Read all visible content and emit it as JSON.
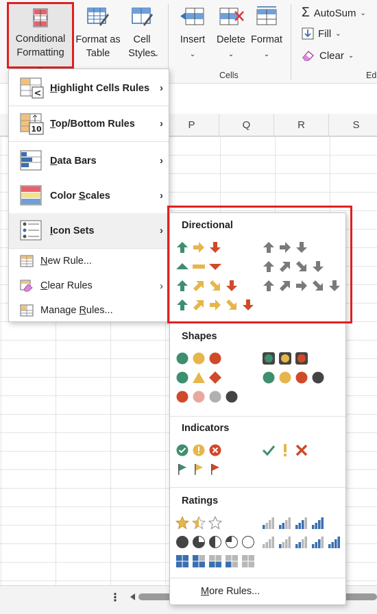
{
  "ribbon": {
    "conditional_formatting": "Conditional\nFormatting",
    "format_as_table": "Format as\nTable",
    "cell_styles": "Cell\nStyles",
    "insert": "Insert",
    "delete": "Delete",
    "format": "Format",
    "cells_group": "Cells",
    "editing_group_partial": "Edi",
    "autosum": "AutoSum",
    "fill": "Fill",
    "clear": "Clear"
  },
  "sheet": {
    "columns": [
      "P",
      "Q",
      "R",
      "S"
    ]
  },
  "menu": {
    "items": [
      {
        "pre": "",
        "ul": "H",
        "post": "ighlight Cells Rules"
      },
      {
        "pre": "",
        "ul": "T",
        "post": "op/Bottom Rules"
      },
      {
        "pre": "",
        "ul": "D",
        "post": "ata Bars"
      },
      {
        "pre": "Color ",
        "ul": "S",
        "post": "cales"
      },
      {
        "pre": "",
        "ul": "I",
        "post": "con Sets"
      },
      {
        "pre": "",
        "ul": "N",
        "post": "ew Rule..."
      },
      {
        "pre": "",
        "ul": "C",
        "post": "lear Rules"
      },
      {
        "pre": "Manage ",
        "ul": "R",
        "post": "ules..."
      }
    ]
  },
  "submenu": {
    "directional": "Directional",
    "shapes": "Shapes",
    "indicators": "Indicators",
    "ratings": "Ratings",
    "more_rules_pre": "",
    "more_rules_ul": "M",
    "more_rules_post": "ore Rules..."
  },
  "colors": {
    "green": "#3d8f6e",
    "yellow": "#e6b64a",
    "red": "#d04a2a",
    "gray": "#7a7a7a",
    "accent_red_box": "#e02020",
    "pink": "#e8a8a0",
    "light_gray": "#b0b0b0",
    "dark": "#444444",
    "blue": "#3a6fb0"
  }
}
